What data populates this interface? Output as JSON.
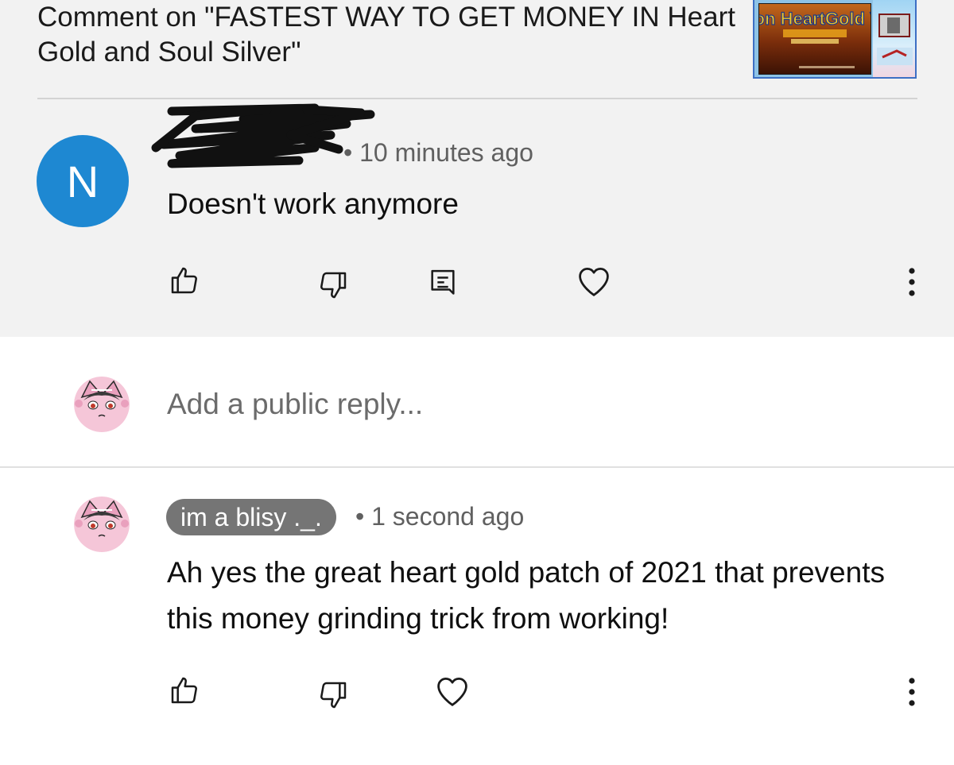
{
  "header": {
    "title": "Comment on \"FASTEST WAY TO GET MONEY IN Heart Gold and Soul Silver\"",
    "video_thumbnail": {
      "logo_text": "Pokémon HeartGold Version",
      "brand_color": "#3d6fc4"
    }
  },
  "comment": {
    "author_initial": "N",
    "avatar_color": "#1e88d2",
    "author_name_redacted": true,
    "meta": "• 10 minutes ago",
    "text": "Doesn't work anymore",
    "actions": {
      "like_icon": "thumb-up-icon",
      "dislike_icon": "thumb-down-icon",
      "reply_icon": "reply-comment-icon",
      "heart_icon": "heart-icon",
      "more_icon": "more-vertical-icon"
    }
  },
  "reply_box": {
    "placeholder": "Add a public reply..."
  },
  "reply": {
    "author": "im a blisy ._.",
    "meta": "• 1 second ago",
    "text": "Ah yes the great heart gold patch of 2021 that prevents this money grinding trick from working!",
    "author_chip_color": "#757575"
  }
}
